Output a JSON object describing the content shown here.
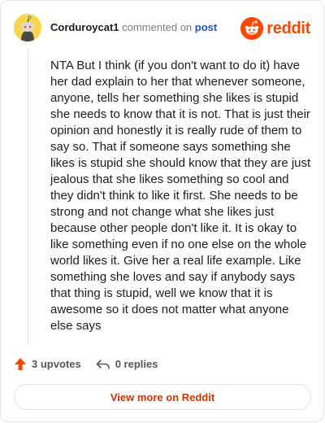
{
  "comment": {
    "username": "Corduroycat1",
    "action": "commented on",
    "post_link": "post",
    "body": "NTA But I think (if you don't want to do it) have her dad explain to her that whenever someone, anyone, tells her something she likes is stupid she needs to know that it is not. That is just their opinion and honestly it is really rude of them to say so. That if someone says something she likes is stupid she should know that they are just jealous that she likes something so cool and they didn't think to like it first. She needs to be strong and not change what she likes just because other people don't like it. It is okay to like something even if no one else on the whole world likes it. Give her a real life example. Like something she loves and say if anybody says that thing is stupid, well we know that it is awesome so it does not matter what anyone else says"
  },
  "brand": {
    "wordmark": "reddit",
    "icon": "reddit-snoo-icon",
    "color": "#ff4500"
  },
  "stats": {
    "upvotes": "3 upvotes",
    "replies": "0 replies",
    "upvote_icon": "upvote-arrow-icon",
    "reply_icon": "reply-arrow-icon",
    "upvote_color": "#ff4500"
  },
  "footer": {
    "view_more": "View more on Reddit"
  }
}
